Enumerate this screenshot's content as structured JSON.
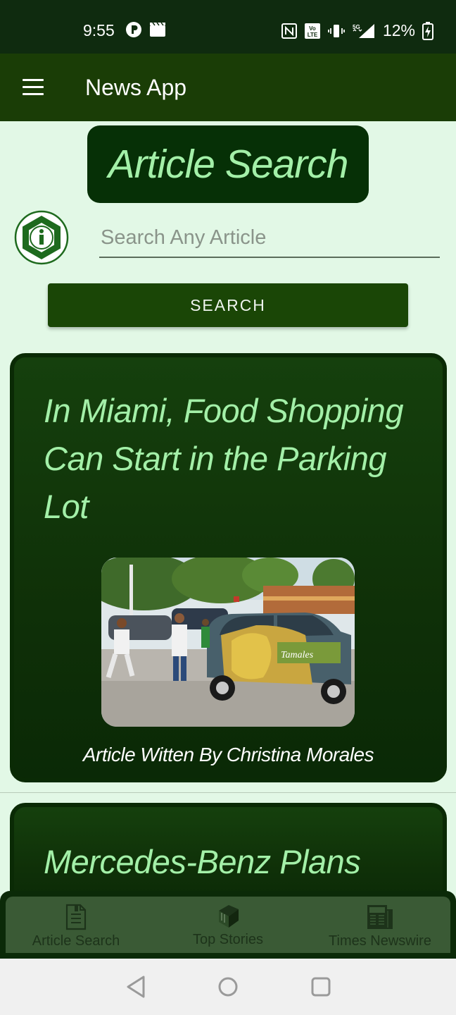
{
  "status_bar": {
    "time": "9:55",
    "battery_percent": "12%"
  },
  "app_bar": {
    "title": "News App",
    "menu_icon": "hamburger-menu-icon"
  },
  "header": {
    "title": "Article Search"
  },
  "search": {
    "placeholder": "Search Any Article",
    "value": "",
    "button_label": "SEARCH"
  },
  "articles": [
    {
      "title": "In Miami, Food Shopping Can Start in the Parking Lot",
      "byline": "Article Witten By Christina Morales"
    },
    {
      "title": "Mercedes-Benz Plans"
    }
  ],
  "bottom_nav": {
    "items": [
      {
        "label": "Article Search",
        "icon": "document-icon"
      },
      {
        "label": "Top Stories",
        "icon": "book-icon"
      },
      {
        "label": "Times Newswire",
        "icon": "newspaper-icon"
      }
    ]
  },
  "colors": {
    "app_bar": "#1a3d06",
    "status_bar": "#0f2b0f",
    "background": "#e2f8e6",
    "title_green": "#a3f0a8",
    "card": "#0f3008"
  }
}
